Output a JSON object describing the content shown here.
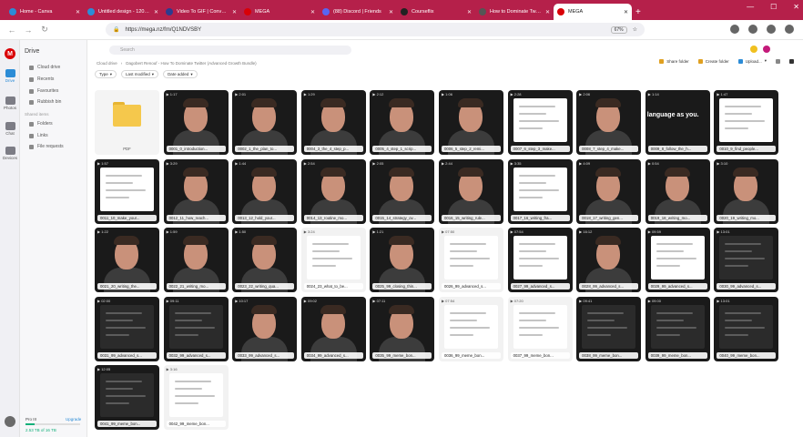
{
  "browser": {
    "tabs": [
      {
        "label": "Home - Canva",
        "color": "#2c8cd6",
        "active": false
      },
      {
        "label": "Untitled design - 1200 × 7...",
        "color": "#2c8cd6",
        "active": false
      },
      {
        "label": "Video To GIF | Convert Vid...",
        "color": "#2d3b8f",
        "active": false
      },
      {
        "label": "MEGA",
        "color": "#d90007",
        "active": false
      },
      {
        "label": "(88) Discord | Friends",
        "color": "#5865f2",
        "active": false
      },
      {
        "label": "Courseflix",
        "color": "#222222",
        "active": false
      },
      {
        "label": "How to Dominate Twitter ...",
        "color": "#555555",
        "active": false
      },
      {
        "label": "MEGA",
        "color": "#d90007",
        "active": true
      }
    ],
    "url": "https://mega.nz/fm/Q1NDVSBY",
    "zoom": "67%"
  },
  "rail": {
    "items": [
      {
        "label": "Drive",
        "active": true
      },
      {
        "label": "Photos",
        "active": false
      },
      {
        "label": "Chat",
        "active": false
      },
      {
        "label": "Devices",
        "active": false
      }
    ]
  },
  "panel": {
    "title": "Drive",
    "items": [
      "Cloud drive",
      "Recents",
      "Favourites",
      "Rubbish bin"
    ],
    "section": "Shared items",
    "shared_items": [
      "Folders",
      "Links",
      "File requests"
    ],
    "storage_label": "Pro III",
    "storage_upgrade": "Upgrade",
    "storage_used": "2.53 TB of 16 TB",
    "storage_fraction": 0.16
  },
  "main": {
    "search_placeholder": "Search",
    "breadcrumb": [
      "Cloud drive",
      "›",
      "Dagobert Renouf - How To Dominate Twitter (Advanced Growth Bundle)"
    ],
    "actions": [
      "Share folder",
      "Create folder",
      "Upload..."
    ],
    "filters": [
      "Type",
      "Last modified",
      "Date added"
    ]
  },
  "tiles": [
    {
      "kind": "folder",
      "dur": "",
      "caption": "PDF"
    },
    {
      "kind": "face",
      "dur": "▶ 1:17",
      "caption": "0001_0_introduction..."
    },
    {
      "kind": "face",
      "dur": "▶ 2:01",
      "caption": "0002_1_the_plan_to..."
    },
    {
      "kind": "face",
      "dur": "▶ 1:29",
      "caption": "0004_3_the_4_step_p..."
    },
    {
      "kind": "face",
      "dur": "▶ 2:12",
      "caption": "0005_4_step_1_scrip..."
    },
    {
      "kind": "face",
      "dur": "▶ 1:06",
      "caption": "0006_5_step_2_remi..."
    },
    {
      "kind": "shot",
      "dur": "▶ 2:28",
      "caption": "0007_6_step_3_make..."
    },
    {
      "kind": "face",
      "dur": "▶ 2:06",
      "caption": "0008_7_step_4_make..."
    },
    {
      "kind": "text",
      "dur": "▶ 1:14",
      "caption": "0009_8_follow_the_h...",
      "bigtext": "language as you."
    },
    {
      "kind": "shot",
      "dur": "▶ 1:47",
      "caption": "0010_9_find_people..."
    },
    {
      "kind": "shot",
      "dur": "▶ 1:57",
      "caption": "0011_10_make_your..."
    },
    {
      "kind": "face",
      "dur": "▶ 3:29",
      "caption": "0012_11_how_reach..."
    },
    {
      "kind": "face",
      "dur": "▶ 1:44",
      "caption": "0013_12_hold_your..."
    },
    {
      "kind": "face",
      "dur": "▶ 2:54",
      "caption": "0014_13_routine_mo..."
    },
    {
      "kind": "face",
      "dur": "▶ 2:05",
      "caption": "0015_14_strategy_ov..."
    },
    {
      "kind": "face",
      "dur": "▶ 2:44",
      "caption": "0016_15_writing_rule..."
    },
    {
      "kind": "shot",
      "dur": "▶ 3:35",
      "caption": "0017_16_writing_fra..."
    },
    {
      "kind": "face",
      "dur": "▶ 4:09",
      "caption": "0018_17_writing_gen..."
    },
    {
      "kind": "face",
      "dur": "▶ 0:54",
      "caption": "0019_18_writing_mo..."
    },
    {
      "kind": "face",
      "dur": "▶ 3:10",
      "caption": "0020_19_writing_mo..."
    },
    {
      "kind": "face",
      "dur": "▶ 1:22",
      "caption": "0021_20_writing_the..."
    },
    {
      "kind": "face",
      "dur": "▶ 1:59",
      "caption": "0022_21_writing_mo..."
    },
    {
      "kind": "face",
      "dur": "▶ 1:50",
      "caption": "0023_22_writing_qua..."
    },
    {
      "kind": "sketch",
      "dur": "▶ 3:24",
      "caption": "0024_23_what_to_be..."
    },
    {
      "kind": "face",
      "dur": "▶ 1:21",
      "caption": "0025_99_closing_thin..."
    },
    {
      "kind": "lightshot",
      "dur": "▶ 07:50",
      "caption": "0026_99_advanced_s..."
    },
    {
      "kind": "shot",
      "dur": "▶ 07:54",
      "caption": "0027_99_advanced_s..."
    },
    {
      "kind": "face",
      "dur": "▶ 16:12",
      "caption": "0028_99_advanced_s..."
    },
    {
      "kind": "shot",
      "dur": "▶ 09:59",
      "caption": "0029_99_advanced_s..."
    },
    {
      "kind": "darkshot",
      "dur": "▶ 13:01",
      "caption": "0030_99_advanced_s..."
    },
    {
      "kind": "darkshot",
      "dur": "▶ 02:00",
      "caption": "0031_99_advanced_s..."
    },
    {
      "kind": "darkshot",
      "dur": "▶ 09:11",
      "caption": "0032_99_advanced_s..."
    },
    {
      "kind": "face",
      "dur": "▶ 10:17",
      "caption": "0033_99_advanced_s..."
    },
    {
      "kind": "face",
      "dur": "▶ 09:02",
      "caption": "0034_99_advanced_s..."
    },
    {
      "kind": "face",
      "dur": "▶ 07:11",
      "caption": "0035_99_meme_bon..."
    },
    {
      "kind": "lightshot",
      "dur": "▶ 07:54",
      "caption": "0036_99_meme_bon..."
    },
    {
      "kind": "lightshot",
      "dur": "▶ 07:20",
      "caption": "0037_99_meme_bon..."
    },
    {
      "kind": "darkshot",
      "dur": "▶ 09:41",
      "caption": "0038_99_meme_bon..."
    },
    {
      "kind": "darkshot",
      "dur": "▶ 09:00",
      "caption": "0039_99_meme_bon..."
    },
    {
      "kind": "darkshot",
      "dur": "▶ 13:01",
      "caption": "0040_99_meme_bon..."
    },
    {
      "kind": "darkshot",
      "dur": "▶ 12:05",
      "caption": "0041_99_meme_bon..."
    },
    {
      "kind": "lightshot",
      "dur": "▶ 3:16",
      "caption": "0042_99_meme_bon..."
    }
  ]
}
